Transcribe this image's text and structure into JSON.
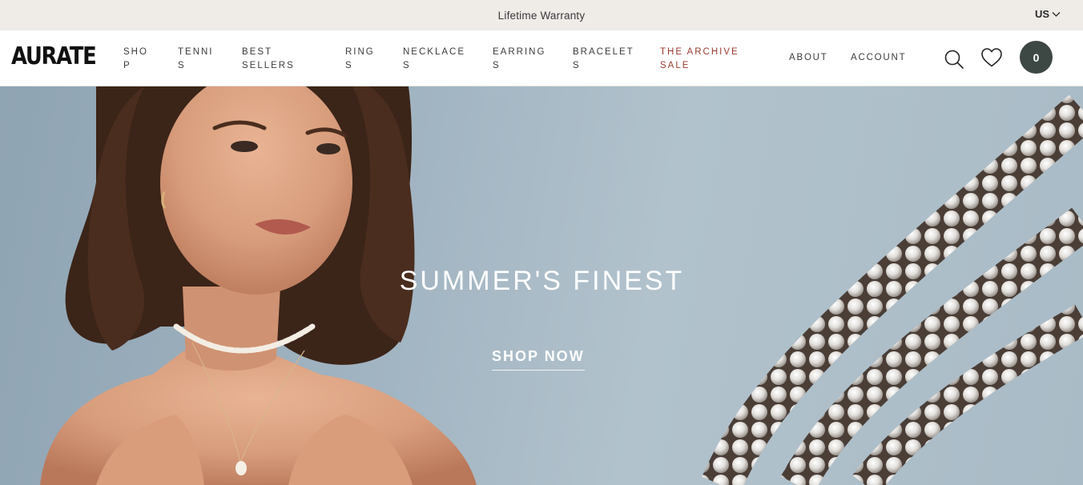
{
  "announcement": {
    "text": "Lifetime Warranty"
  },
  "region": {
    "label": "US",
    "icon": "chevron-down-icon"
  },
  "header": {
    "logo": "AURATE",
    "nav": [
      {
        "label": "SHO\nP"
      },
      {
        "label": "TENNI\nS"
      },
      {
        "label": "BEST\nSELLERS"
      },
      {
        "label": "RING\nS"
      },
      {
        "label": "NECKLACE\nS"
      },
      {
        "label": "EARRING\nS"
      },
      {
        "label": "BRACELET\nS"
      },
      {
        "label": "THE ARCHIVE\nSALE"
      }
    ],
    "about": "ABOUT",
    "account": "ACCOUNT",
    "search_icon": "search-icon",
    "wishlist_icon": "heart-icon",
    "cart_count": "0"
  },
  "hero": {
    "title": "SUMMER'S FINEST",
    "cta": "SHOP NOW"
  },
  "colors": {
    "announcement_bg": "#efebe7",
    "sale": "#9b3a2e",
    "cart_bg": "#3d4744",
    "hero_bg": "#a9bbc6"
  }
}
